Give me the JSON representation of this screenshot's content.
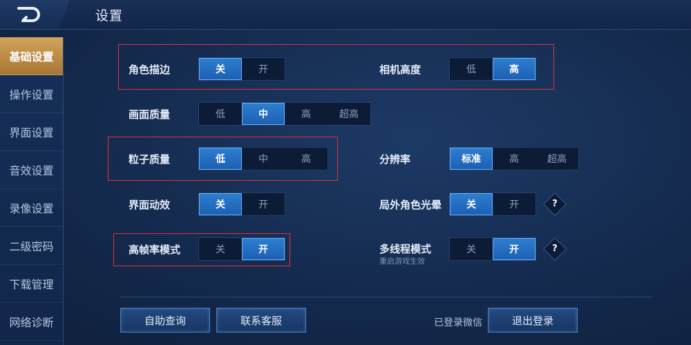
{
  "header": {
    "title": "设置"
  },
  "sidebar": {
    "items": [
      {
        "label": "基础设置",
        "active": true
      },
      {
        "label": "操作设置"
      },
      {
        "label": "界面设置"
      },
      {
        "label": "音效设置"
      },
      {
        "label": "录像设置"
      },
      {
        "label": "二级密码"
      },
      {
        "label": "下载管理"
      },
      {
        "label": "网络诊断"
      }
    ]
  },
  "settings": {
    "outline": {
      "label": "角色描边",
      "options": [
        "关",
        "开"
      ],
      "selected": "关"
    },
    "camera": {
      "label": "相机高度",
      "options": [
        "低",
        "高"
      ],
      "selected": "高"
    },
    "quality": {
      "label": "画面质量",
      "options": [
        "低",
        "中",
        "高",
        "超高"
      ],
      "selected": "中"
    },
    "particle": {
      "label": "粒子质量",
      "options": [
        "低",
        "中",
        "高"
      ],
      "selected": "低"
    },
    "resolution": {
      "label": "分辨率",
      "options": [
        "标准",
        "高",
        "超高"
      ],
      "selected": "标准"
    },
    "ui_effect": {
      "label": "界面动效",
      "options": [
        "关",
        "开"
      ],
      "selected": "关"
    },
    "outside_glow": {
      "label": "局外角色光晕",
      "options": [
        "关",
        "开"
      ],
      "selected": "关"
    },
    "high_fps": {
      "label": "高帧率模式",
      "options": [
        "关",
        "开"
      ],
      "selected": "开"
    },
    "multithread": {
      "label": "多线程模式",
      "sublabel": "重启游戏生效",
      "options": [
        "关",
        "开"
      ],
      "selected": "开"
    },
    "help_symbol": "?"
  },
  "footer": {
    "self_help": "自助查询",
    "contact": "联系客服",
    "wechat_status": "已登录微信",
    "logout": "退出登录"
  },
  "colors": {
    "accent": "#2d7fd1",
    "active_tab": "#c79548",
    "highlight_box": "#e0343a"
  }
}
